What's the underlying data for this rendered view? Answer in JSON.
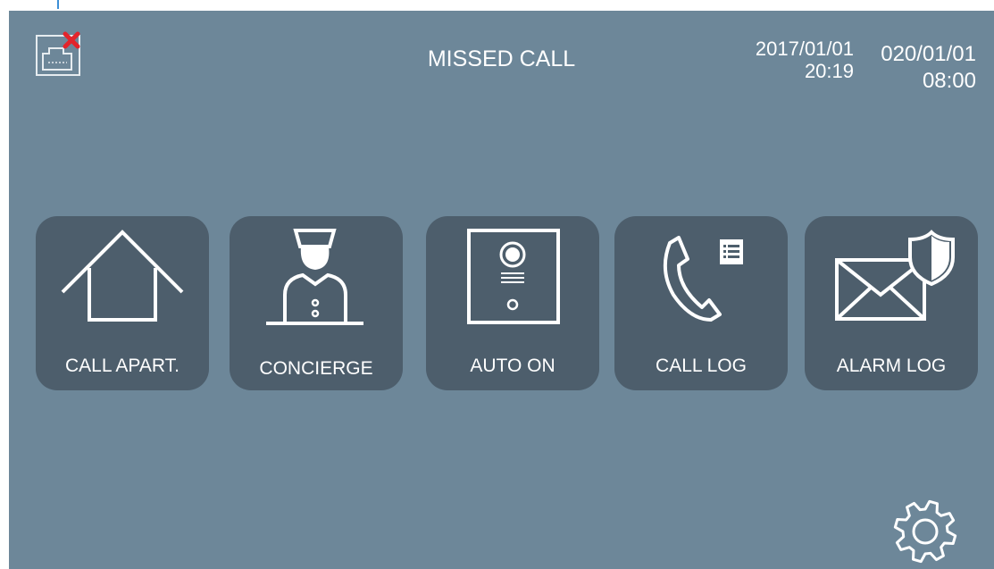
{
  "header": {
    "title": "MISSED CALL",
    "date1": "2017/01/01",
    "time1": "20:19",
    "date2": "020/01/01",
    "time2": "08:00"
  },
  "status_icon": "network-disconnected-icon",
  "colors": {
    "background": "#6d8799",
    "tile": "#4d5e6c",
    "text": "#ffffff",
    "alert": "#e3242b"
  },
  "menu": [
    {
      "label": "CALL APART.",
      "icon": "house-icon"
    },
    {
      "label": "CONCIERGE",
      "icon": "concierge-icon"
    },
    {
      "label": "AUTO ON",
      "icon": "door-station-icon"
    },
    {
      "label": "CALL LOG",
      "icon": "phone-log-icon"
    },
    {
      "label": "ALARM LOG",
      "icon": "envelope-shield-icon"
    }
  ],
  "settings_icon": "gear-icon"
}
